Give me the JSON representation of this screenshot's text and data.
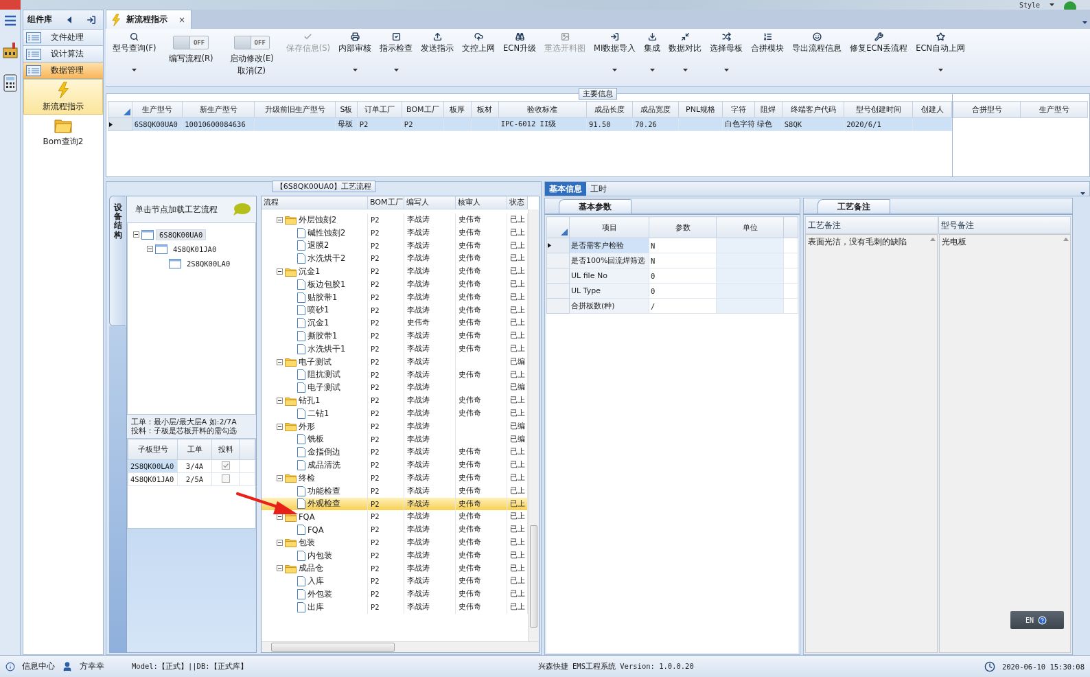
{
  "app_bar": {
    "style_menu": "Style"
  },
  "sidebar": {
    "title": "组件库",
    "groups": [
      {
        "label": "文件处理",
        "selected": false
      },
      {
        "label": "设计算法",
        "selected": false
      },
      {
        "label": "数据管理",
        "selected": true
      }
    ],
    "items": [
      {
        "label": "新流程指示",
        "selected": true
      },
      {
        "label": "Bom查询2",
        "selected": false
      }
    ]
  },
  "document_tab": {
    "title": "新流程指示",
    "close": "×"
  },
  "toolbar": {
    "buttons": [
      {
        "kind": "button",
        "label": "型号查询(F)",
        "disabled": false,
        "menu": true
      },
      {
        "kind": "toggle",
        "label": "编写流程(R)",
        "switch_text": "OFF",
        "on": false,
        "disabled": false,
        "menu": false
      },
      {
        "kind": "toggle",
        "label": "启动修改(E)",
        "second_label": "取消(Z)",
        "switch_text": "OFF",
        "on": false,
        "disabled": false,
        "menu": false
      },
      {
        "kind": "button",
        "label": "保存信息(S)",
        "disabled": true,
        "menu": false
      },
      {
        "kind": "button",
        "label": "内部审核",
        "disabled": false,
        "menu": true
      },
      {
        "kind": "button",
        "label": "指示检查",
        "disabled": false,
        "menu": true
      },
      {
        "kind": "button",
        "label": "发送指示",
        "disabled": false,
        "menu": false
      },
      {
        "kind": "button",
        "label": "文控上网",
        "disabled": false,
        "menu": false
      },
      {
        "kind": "button",
        "label": "ECN升级",
        "disabled": false,
        "menu": false
      },
      {
        "kind": "button",
        "label": "重选开料图",
        "disabled": true,
        "menu": false
      },
      {
        "kind": "button",
        "label": "MI数据导入",
        "disabled": false,
        "menu": true
      },
      {
        "kind": "button",
        "label": "集成",
        "disabled": false,
        "menu": true
      },
      {
        "kind": "button",
        "label": "数据对比",
        "disabled": false,
        "menu": true
      },
      {
        "kind": "button",
        "label": "选择母板",
        "disabled": false,
        "menu": true
      },
      {
        "kind": "button",
        "label": "合拼模块",
        "disabled": false,
        "menu": false
      },
      {
        "kind": "button",
        "label": "导出流程信息",
        "disabled": false,
        "menu": false
      },
      {
        "kind": "button",
        "label": "修复ECN丢流程",
        "disabled": false,
        "menu": false
      },
      {
        "kind": "button",
        "label": "ECN自动上网",
        "disabled": false,
        "menu": true
      }
    ]
  },
  "main_info": {
    "title": "主要信息",
    "columns": [
      "生产型号",
      "新生产型号",
      "升级前旧生产型号",
      "S板",
      "订单工厂",
      "BOM工厂",
      "板厚",
      "板材",
      "验收标准",
      "成品长度",
      "成品宽度",
      "PNL规格",
      "字符",
      "阻焊",
      "终端客户代码",
      "型号创建时间",
      "创建人"
    ],
    "rows": [
      {
        "selected": true,
        "cells": [
          "6S8QK00UA0",
          "10010600084636",
          null,
          "母板",
          "P2",
          "P2",
          null,
          null,
          "IPC-6012 II级",
          "91.50",
          "70.26",
          null,
          "白色字符",
          "绿色",
          "S8QK",
          "2020/6/1",
          null
        ]
      }
    ],
    "merge_table": {
      "columns": [
        "合拼型号",
        "生产型号"
      ]
    }
  },
  "process": {
    "title": "【6S8QK00UA0】工艺流程",
    "side_tab": "设备结构",
    "hint": "单击节点加载工艺流程",
    "structure_tree": [
      {
        "label": "6S8QK00UA0",
        "selected": true,
        "children": [
          {
            "label": "4S8QK01JA0",
            "selected": false,
            "children": [
              {
                "label": "2S8QK00LA0",
                "selected": false
              }
            ]
          }
        ]
      }
    ],
    "notes": [
      "工单：最小层/最大层A 如:2/7A",
      "投料：子板是芯板开料的需勾选"
    ],
    "sub_table": {
      "columns": [
        "子板型号",
        "工单",
        "投料"
      ],
      "rows": [
        {
          "model": "2S8QK00LA0",
          "order": "3/4A",
          "checked": true,
          "selected": true
        },
        {
          "model": "4S8QK01JA0",
          "order": "2/5A",
          "checked": false,
          "selected": false
        }
      ]
    },
    "flow_table": {
      "columns": [
        "流程",
        "BOM工厂",
        "编写人",
        "核审人",
        "状态"
      ],
      "rows": [
        {
          "name": "外层蚀刻2",
          "bom": "P2",
          "writer": "李战涛",
          "reviewer": "史伟奇",
          "status": "已上",
          "selected": false,
          "children": [
            {
              "name": "碱性蚀刻2",
              "bom": "P2",
              "writer": "李战涛",
              "reviewer": "史伟奇",
              "status": "已上",
              "selected": false
            },
            {
              "name": "退膜2",
              "bom": "P2",
              "writer": "李战涛",
              "reviewer": "史伟奇",
              "status": "已上",
              "selected": false
            },
            {
              "name": "水洗烘干2",
              "bom": "P2",
              "writer": "李战涛",
              "reviewer": "史伟奇",
              "status": "已上",
              "selected": false
            }
          ]
        },
        {
          "name": "沉金1",
          "bom": "P2",
          "writer": "李战涛",
          "reviewer": "史伟奇",
          "status": "已上",
          "selected": false,
          "children": [
            {
              "name": "板边包胶1",
              "bom": "P2",
              "writer": "李战涛",
              "reviewer": "史伟奇",
              "status": "已上",
              "selected": false
            },
            {
              "name": "贴胶带1",
              "bom": "P2",
              "writer": "李战涛",
              "reviewer": "史伟奇",
              "status": "已上",
              "selected": false
            },
            {
              "name": "喷砂1",
              "bom": "P2",
              "writer": "李战涛",
              "reviewer": "史伟奇",
              "status": "已上",
              "selected": false
            },
            {
              "name": "沉金1",
              "bom": "P2",
              "writer": "史伟奇",
              "reviewer": "史伟奇",
              "status": "已上",
              "selected": false
            },
            {
              "name": "撕胶带1",
              "bom": "P2",
              "writer": "李战涛",
              "reviewer": "史伟奇",
              "status": "已上",
              "selected": false
            },
            {
              "name": "水洗烘干1",
              "bom": "P2",
              "writer": "李战涛",
              "reviewer": "史伟奇",
              "status": "已上",
              "selected": false
            }
          ]
        },
        {
          "name": "电子测试",
          "bom": "P2",
          "writer": "李战涛",
          "status": "已编",
          "selected": false,
          "children": [
            {
              "name": "阻抗测试",
              "bom": "P2",
              "writer": "李战涛",
              "reviewer": "史伟奇",
              "status": "已上",
              "selected": false
            },
            {
              "name": "电子测试",
              "bom": "P2",
              "writer": "李战涛",
              "status": "已编",
              "selected": false
            }
          ]
        },
        {
          "name": "钻孔1",
          "bom": "P2",
          "writer": "李战涛",
          "reviewer": "史伟奇",
          "status": "已上",
          "selected": false,
          "children": [
            {
              "name": "二钻1",
              "bom": "P2",
              "writer": "李战涛",
              "reviewer": "史伟奇",
              "status": "已上",
              "selected": false
            }
          ]
        },
        {
          "name": "外形",
          "bom": "P2",
          "writer": "李战涛",
          "status": "已编",
          "selected": false,
          "children": [
            {
              "name": "铣板",
              "bom": "P2",
              "writer": "李战涛",
              "status": "已编",
              "selected": false
            },
            {
              "name": "金指倒边",
              "bom": "P2",
              "writer": "李战涛",
              "reviewer": "史伟奇",
              "status": "已上",
              "selected": false
            },
            {
              "name": "成品清洗",
              "bom": "P2",
              "writer": "李战涛",
              "reviewer": "史伟奇",
              "status": "已上",
              "selected": false
            }
          ]
        },
        {
          "name": "终检",
          "bom": "P2",
          "writer": "李战涛",
          "reviewer": "史伟奇",
          "status": "已上",
          "selected": false,
          "children": [
            {
              "name": "功能检查",
              "bom": "P2",
              "writer": "李战涛",
              "reviewer": "史伟奇",
              "status": "已上",
              "selected": false
            },
            {
              "name": "外观检查",
              "bom": "P2",
              "writer": "李战涛",
              "reviewer": "史伟奇",
              "status": "已上",
              "selected": true
            }
          ]
        },
        {
          "name": "FQA",
          "bom": "P2",
          "writer": "李战涛",
          "reviewer": "史伟奇",
          "status": "已上",
          "selected": false,
          "children": [
            {
              "name": "FQA",
              "bom": "P2",
              "writer": "李战涛",
              "reviewer": "史伟奇",
              "status": "已上",
              "selected": false
            }
          ]
        },
        {
          "name": "包装",
          "bom": "P2",
          "writer": "李战涛",
          "reviewer": "史伟奇",
          "status": "已上",
          "selected": false,
          "children": [
            {
              "name": "内包装",
              "bom": "P2",
              "writer": "李战涛",
              "reviewer": "史伟奇",
              "status": "已上",
              "selected": false
            }
          ]
        },
        {
          "name": "成品仓",
          "bom": "P2",
          "writer": "李战涛",
          "reviewer": "史伟奇",
          "status": "已上",
          "selected": false,
          "children": [
            {
              "name": "入库",
              "bom": "P2",
              "writer": "李战涛",
              "reviewer": "史伟奇",
              "status": "已上",
              "selected": false
            },
            {
              "name": "外包装",
              "bom": "P2",
              "writer": "李战涛",
              "reviewer": "史伟奇",
              "status": "已上",
              "selected": false
            },
            {
              "name": "出库",
              "bom": "P2",
              "writer": "李战涛",
              "reviewer": "史伟奇",
              "status": "已上",
              "selected": false
            }
          ]
        }
      ]
    }
  },
  "details": {
    "tabs": [
      {
        "label": "基本信息",
        "selected": true
      },
      {
        "label": "工时",
        "selected": false
      }
    ],
    "params": {
      "tab": "基本参数",
      "columns": [
        "项目",
        "参数",
        "单位"
      ],
      "rows": [
        {
          "item": "是否需客户检验",
          "value": "N",
          "selected": true
        },
        {
          "item": "是否100%回流焊筛选",
          "value": "N",
          "selected": false
        },
        {
          "item": "UL file No",
          "value": "0",
          "selected": false
        },
        {
          "item": "UL Type",
          "value": "0",
          "selected": false
        },
        {
          "item": "合拼板数(种)",
          "value": "/",
          "selected": false
        }
      ]
    },
    "remarks": {
      "tab": "工艺备注",
      "columns": [
        "工艺备注",
        "型号备注"
      ],
      "values": [
        "表面光洁，没有毛刺的缺陷",
        "光电板"
      ]
    }
  },
  "ime": {
    "label": "EN"
  },
  "status_bar": {
    "info": "信息中心",
    "user": "方幸幸",
    "environment": "Model:【正式】||DB:【正式库】",
    "system": "兴森快捷 EMS工程系统 Version: 1.0.0.20",
    "datetime": "2020-06-10 15:30:08"
  }
}
